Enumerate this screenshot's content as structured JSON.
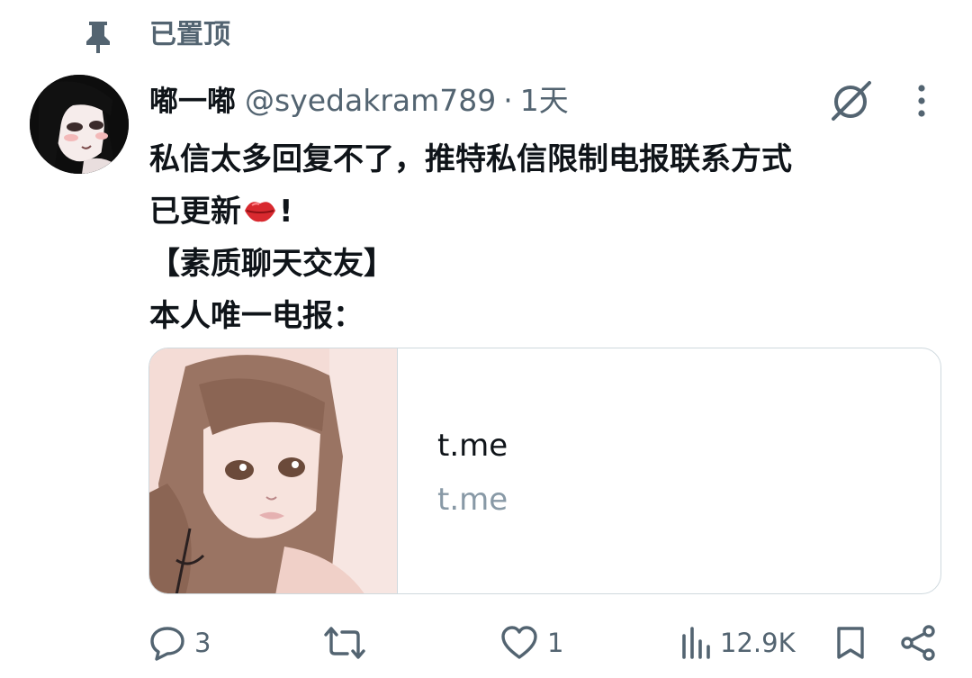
{
  "pinned": {
    "label": "已置顶"
  },
  "tweet": {
    "display_name": "嘟一嘟",
    "handle": "@syedakram789",
    "separator": "·",
    "time": "1天",
    "lines": [
      "私信太多回复不了，推特私信限制电报联系方式",
      "已更新",
      "!",
      "【素质聊天交友】",
      "本人唯一电报："
    ]
  },
  "card": {
    "title": "t.me",
    "domain": "t.me"
  },
  "actions": {
    "reply_count": "3",
    "retweet_count": "",
    "like_count": "1",
    "view_count": "12.9K"
  },
  "icons": [
    "pin-icon",
    "grok-icon",
    "more-icon",
    "kiss-emoji",
    "reply-icon",
    "retweet-icon",
    "like-icon",
    "views-icon",
    "bookmark-icon",
    "share-icon"
  ],
  "colors": {
    "text": "#0f1419",
    "secondary": "#536471",
    "border": "#cfd9de",
    "domain": "#8899a6"
  }
}
